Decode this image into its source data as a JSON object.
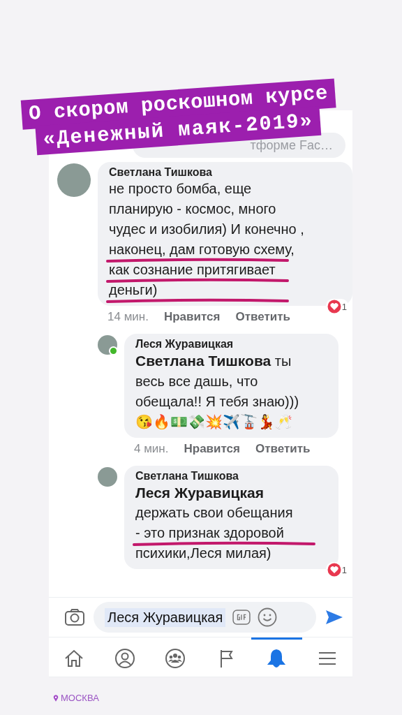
{
  "sticker": {
    "lines": [
      "О скором роскошном курсе",
      "«Денежный маяк-2019»"
    ]
  },
  "search": {
    "placeholder": "тформе Fac…"
  },
  "comments": [
    {
      "author": "Светлана Тишкова",
      "reply": false,
      "online": false,
      "lines": [
        {
          "text": "не просто бомба, еще",
          "underlined": false
        },
        {
          "text": "планирую - космос, много",
          "underlined": false
        },
        {
          "text": "чудес и изобилия) И конечно ,",
          "underlined": false
        },
        {
          "text": "наконец, дам готовую схему,",
          "underlined": true
        },
        {
          "text": "как сознание притягивает",
          "underlined": true
        },
        {
          "text": "деньги)",
          "underlined": true
        }
      ],
      "time": "14 мин.",
      "like": "Нравится",
      "answer": "Ответить",
      "reactions": "1"
    },
    {
      "author": "Леся Журавицкая",
      "reply": true,
      "online": true,
      "mention": "Светлана Тишкова",
      "kind": "inline",
      "lines": [
        {
          "text": "ты",
          "underlined": false
        },
        {
          "text": "весь все дашь, что",
          "underlined": false
        },
        {
          "text": "обещала!! Я тебя знаю)))",
          "underlined": false
        },
        {
          "text": "😘🔥💵💸💥✈️🚡💃🥂",
          "underlined": false
        }
      ],
      "time": "4 мин.",
      "like": "Нравится",
      "answer": "Ответить"
    },
    {
      "author": "Светлана Тишкова",
      "reply": true,
      "online": false,
      "mention": "Леся Журавицкая",
      "kind": "block",
      "lines": [
        {
          "text": "держать свои обещания",
          "underlined": false
        },
        {
          "text": "- это признак здоровой",
          "underlined": true
        },
        {
          "text": "психики,Леся милая)",
          "underlined": false
        }
      ],
      "reactions": "1"
    }
  ],
  "composer": {
    "value": "Леся Журавицкая"
  },
  "tabs": [
    {
      "kind": "home",
      "selected": false
    },
    {
      "kind": "profile",
      "selected": false
    },
    {
      "kind": "groups",
      "selected": false
    },
    {
      "kind": "pages",
      "selected": false
    },
    {
      "kind": "notifications",
      "selected": true
    },
    {
      "kind": "menu",
      "selected": false
    }
  ],
  "location": "МОСКВА"
}
